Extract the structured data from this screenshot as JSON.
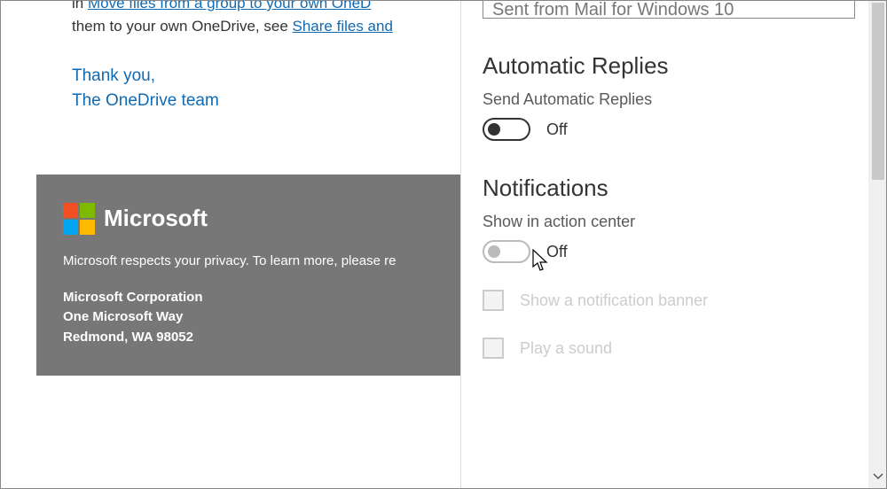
{
  "email": {
    "partial_line_1_prefix": "in ",
    "partial_link_1": "Move files from a group to your own OneD",
    "partial_line_2_prefix": "them to your own OneDrive, see ",
    "partial_link_2": "Share files and",
    "sig_line_1": "Thank you,",
    "sig_line_2": "The OneDrive team"
  },
  "footer": {
    "brand": "Microsoft",
    "privacy": "Microsoft respects your privacy. To learn more, please re",
    "addr1": "Microsoft Corporation",
    "addr2": "One Microsoft Way",
    "addr3": "Redmond, WA 98052"
  },
  "settings": {
    "signature_value": "Sent from Mail for Windows 10",
    "section_auto": "Automatic Replies",
    "auto_label": "Send Automatic Replies",
    "auto_state": "Off",
    "section_notif": "Notifications",
    "notif_label": "Show in action center",
    "notif_state": "Off",
    "cb1": "Show a notification banner",
    "cb2": "Play a sound"
  }
}
